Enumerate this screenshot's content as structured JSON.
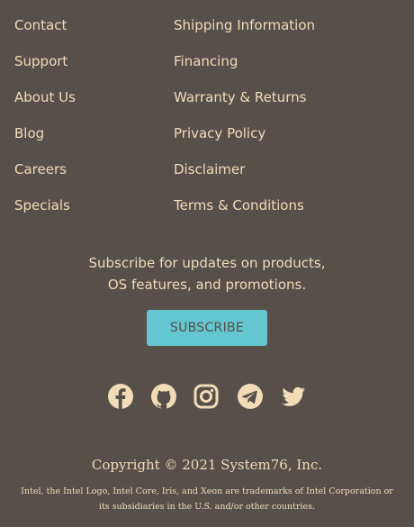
{
  "footer": {
    "left_links": [
      {
        "label": "Contact"
      },
      {
        "label": "Support"
      },
      {
        "label": "About Us"
      },
      {
        "label": "Blog"
      },
      {
        "label": "Careers"
      },
      {
        "label": "Specials"
      }
    ],
    "right_links": [
      {
        "label": "Shipping Information"
      },
      {
        "label": "Financing"
      },
      {
        "label": "Warranty & Returns"
      },
      {
        "label": "Privacy Policy"
      },
      {
        "label": "Disclaimer"
      },
      {
        "label": "Terms & Conditions"
      }
    ],
    "subscribe": {
      "text_line1": "Subscribe for updates on products,",
      "text_line2": "OS features, and promotions.",
      "button_label": "SUBSCRIBE"
    },
    "social_icons": [
      "facebook-icon",
      "github-icon",
      "instagram-icon",
      "telegram-icon",
      "twitter-icon"
    ],
    "copyright": "Copyright © 2021 System76, Inc.",
    "trademark": "Intel, the Intel Logo, Intel Core, Iris, and Xeon are trademarks of Intel Corporation or its subsidiaries in the U.S. and/or other countries."
  },
  "colors": {
    "background": "#574f4a",
    "text": "#f2dcb8",
    "accent": "#63c6d0"
  }
}
